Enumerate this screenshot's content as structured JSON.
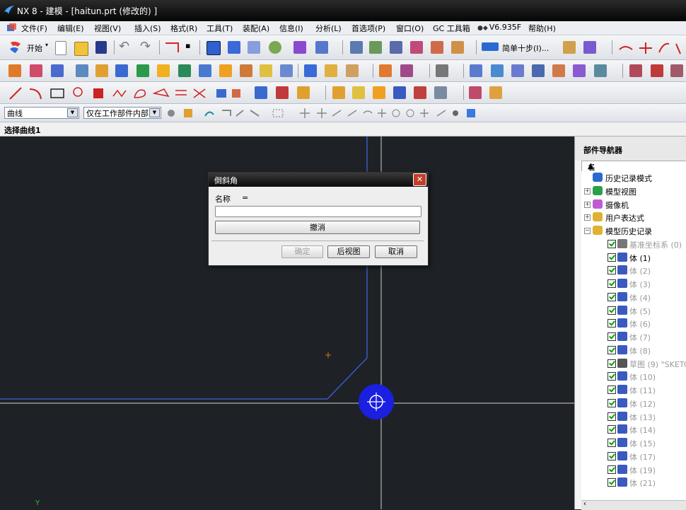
{
  "window": {
    "title": "NX 8 - 建模 - [haitun.prt  (修改的)  ]"
  },
  "menu": [
    {
      "label": "文件(F)"
    },
    {
      "label": "编辑(E)"
    },
    {
      "label": "视图(V)"
    },
    {
      "label": "插入(S)"
    },
    {
      "label": "格式(R)"
    },
    {
      "label": "工具(T)"
    },
    {
      "label": "装配(A)"
    },
    {
      "label": "信息(I)"
    },
    {
      "label": "分析(L)"
    },
    {
      "label": "首选项(P)"
    },
    {
      "label": "窗口(O)"
    },
    {
      "label": "GC 工具箱"
    },
    {
      "label": "V6.935F"
    },
    {
      "label": "帮助(H)"
    }
  ],
  "toolbar": {
    "start_label": "开始",
    "snap_label": "简单十步(I)..."
  },
  "selection_bar": {
    "filter_value": "曲线",
    "scope_value": "仅在工作部件内部"
  },
  "cue_line": "选择曲线1",
  "part_navigator": {
    "title": "部件导航器",
    "column_name": "名称",
    "sort_indicator": "▲",
    "items": [
      {
        "label": "历史记录模式",
        "grey": false
      },
      {
        "label": "模型视图",
        "grey": false
      },
      {
        "label": "摄像机",
        "grey": false
      },
      {
        "label": "用户表达式",
        "grey": false
      },
      {
        "label": "模型历史记录",
        "grey": false
      },
      {
        "label": "基准坐标系 (0)",
        "grey": true
      },
      {
        "label": "体 (1)",
        "grey": false
      },
      {
        "label": "体 (2)",
        "grey": true
      },
      {
        "label": "体 (3)",
        "grey": true
      },
      {
        "label": "体 (4)",
        "grey": true
      },
      {
        "label": "体 (5)",
        "grey": true
      },
      {
        "label": "体 (6)",
        "grey": true
      },
      {
        "label": "体 (7)",
        "grey": true
      },
      {
        "label": "体 (8)",
        "grey": true
      },
      {
        "label": "草图 (9) \"SKETC",
        "grey": true
      },
      {
        "label": "体 (10)",
        "grey": true
      },
      {
        "label": "体 (11)",
        "grey": true
      },
      {
        "label": "体 (12)",
        "grey": true
      },
      {
        "label": "体 (13)",
        "grey": true
      },
      {
        "label": "体 (14)",
        "grey": true
      },
      {
        "label": "体 (15)",
        "grey": true
      },
      {
        "label": "体 (17)",
        "grey": true
      },
      {
        "label": "体 (19)",
        "grey": true
      },
      {
        "label": "体 (21)",
        "grey": true
      }
    ]
  },
  "dialog": {
    "title": "倒斜角",
    "close_glyph": "✕",
    "name_label": "名称",
    "equals": "=",
    "name_value": "",
    "undo_label": "撤消",
    "ok_label": "确定",
    "back_label": "后视图",
    "cancel_label": "取消"
  },
  "graphics": {
    "axis_label": "Y"
  }
}
